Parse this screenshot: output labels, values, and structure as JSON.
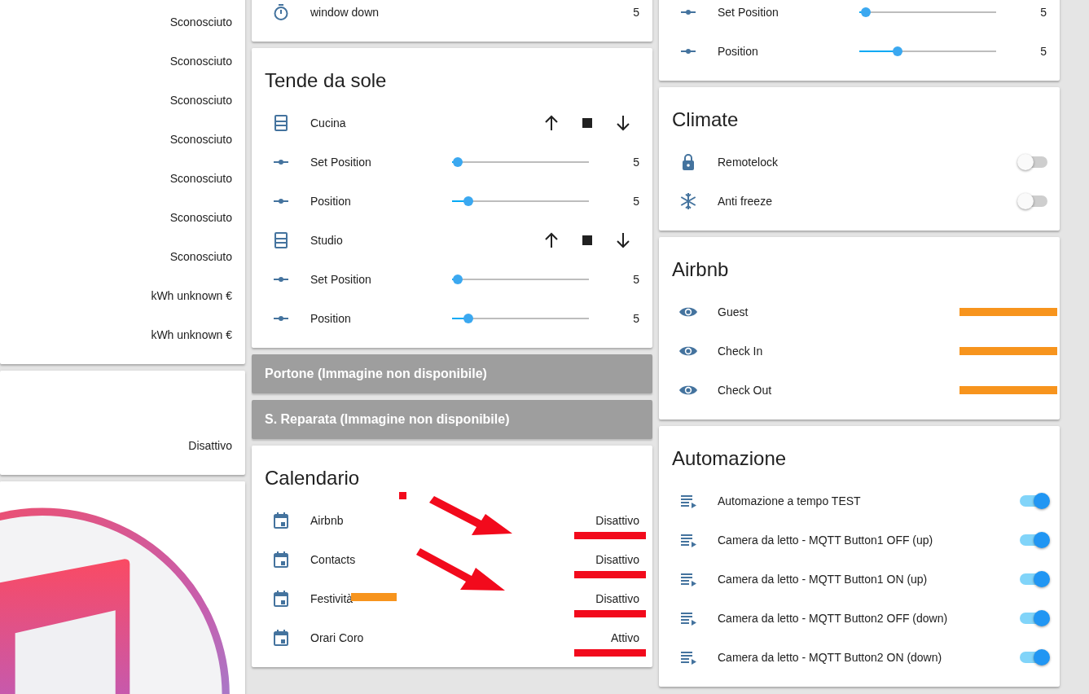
{
  "columns": [
    {
      "cards": [
        {
          "kind": "entities",
          "rows": [
            {
              "kind": "text",
              "value": "Sconosciuto"
            },
            {
              "kind": "text",
              "value": "Sconosciuto"
            },
            {
              "kind": "text",
              "value": "Sconosciuto"
            },
            {
              "kind": "text",
              "value": "Sconosciuto"
            },
            {
              "kind": "text",
              "value": "Sconosciuto"
            },
            {
              "kind": "text",
              "value": "Sconosciuto"
            },
            {
              "kind": "text",
              "value": "Sconosciuto"
            },
            {
              "kind": "text",
              "value": "kWh unknown €"
            },
            {
              "kind": "text",
              "value": "kWh unknown €"
            }
          ]
        },
        {
          "kind": "entities",
          "rows": [
            {
              "kind": "text",
              "value": "Disattivo"
            }
          ]
        },
        {
          "kind": "picture"
        }
      ]
    },
    {
      "cards": [
        {
          "kind": "entities",
          "rows": [
            {
              "kind": "timer",
              "label": "window down",
              "value": "5"
            }
          ]
        },
        {
          "kind": "entities",
          "title": "Tende da sole",
          "rows": [
            {
              "kind": "cover",
              "label": "Cucina"
            },
            {
              "kind": "slider",
              "label": "Set Position",
              "level": 0.04,
              "value": "5"
            },
            {
              "kind": "slider",
              "label": "Position",
              "level": 0.12,
              "value": "5"
            },
            {
              "kind": "cover",
              "label": "Studio"
            },
            {
              "kind": "slider",
              "label": "Set Position",
              "level": 0.04,
              "value": "5"
            },
            {
              "kind": "slider",
              "label": "Position",
              "level": 0.12,
              "value": "5"
            }
          ]
        },
        {
          "kind": "camera",
          "label": "Portone (Immagine non disponibile)"
        },
        {
          "kind": "camera",
          "label": "S. Reparata (Immagine non disponibile)"
        },
        {
          "kind": "calendar",
          "title": "Calendario",
          "rows": [
            {
              "kind": "calendar",
              "label": "Airbnb",
              "value": "Disattivo",
              "underlined": true
            },
            {
              "kind": "calendar",
              "label": "Contacts",
              "value": "Disattivo",
              "underlined": true
            },
            {
              "kind": "calendar",
              "label": "Festività",
              "redacted": true,
              "value": "Disattivo",
              "underlined": true
            },
            {
              "kind": "calendar",
              "label": "Orari Coro",
              "value": "Attivo",
              "underlined": true
            }
          ]
        }
      ]
    },
    {
      "cards": [
        {
          "kind": "entities",
          "rows": [
            {
              "kind": "slider",
              "label": "Set Position",
              "level": 0.05,
              "value": "5"
            },
            {
              "kind": "slider",
              "label": "Position",
              "level": 0.28,
              "value": "5"
            }
          ]
        },
        {
          "kind": "entities",
          "title": "Climate",
          "rows": [
            {
              "kind": "lock",
              "label": "Remotelock",
              "on": false
            },
            {
              "kind": "switch",
              "label": "Anti freeze",
              "on": false
            }
          ]
        },
        {
          "kind": "entities",
          "title": "Airbnb",
          "rows": [
            {
              "kind": "sensor",
              "label": "Guest",
              "redacted": true
            },
            {
              "kind": "sensor",
              "label": "Check In",
              "redacted": true
            },
            {
              "kind": "sensor",
              "label": "Check Out",
              "redacted": true
            }
          ]
        },
        {
          "kind": "entities",
          "title": "Automazione",
          "rows": [
            {
              "kind": "automation",
              "label": "Automazione a tempo TEST",
              "on": true
            },
            {
              "kind": "automation",
              "label": "Camera da letto - MQTT Button1 OFF (up)",
              "on": true
            },
            {
              "kind": "automation",
              "label": "Camera da letto - MQTT Button1 ON (up)",
              "on": true
            },
            {
              "kind": "automation",
              "label": "Camera da letto - MQTT Button2 OFF (down)",
              "on": true
            },
            {
              "kind": "automation",
              "label": "Camera da letto - MQTT Button2 ON (down)",
              "on": true
            }
          ]
        }
      ]
    }
  ]
}
